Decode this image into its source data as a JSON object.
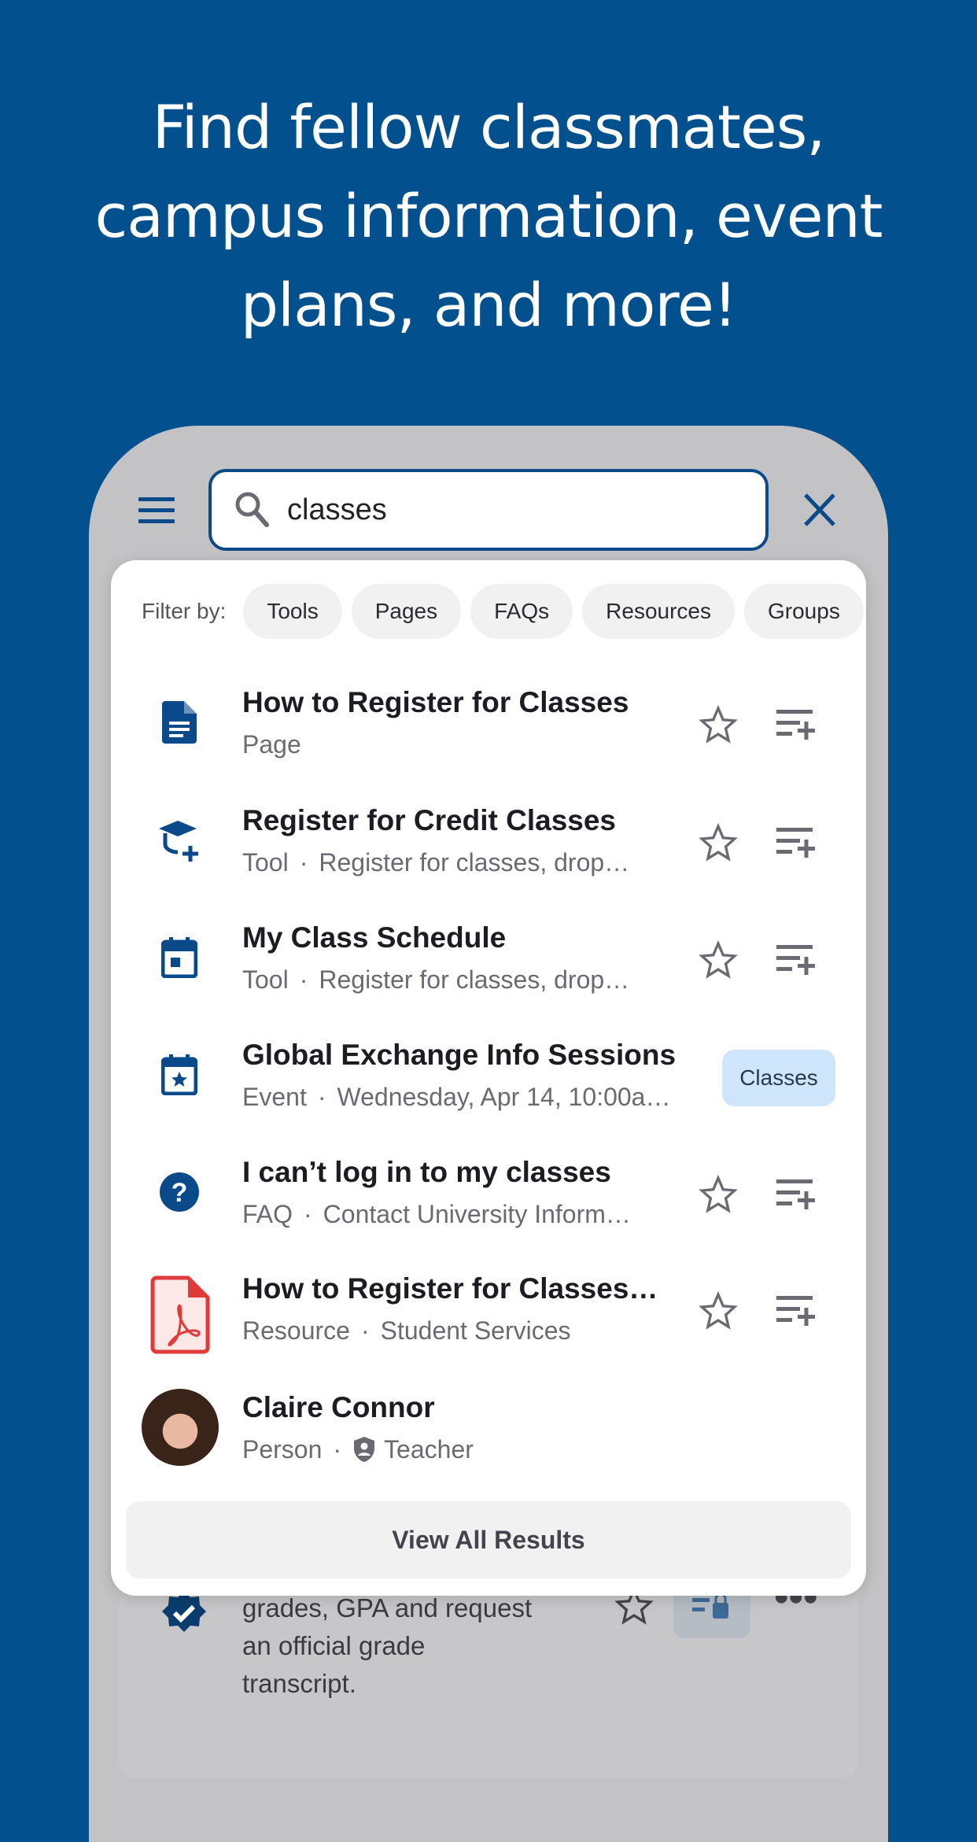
{
  "headline": [
    "Find fellow classmates,",
    "campus information, event",
    "plans, and more!"
  ],
  "search": {
    "value": "classes"
  },
  "filter": {
    "label": "Filter by:",
    "chips": [
      "Tools",
      "Pages",
      "FAQs",
      "Resources",
      "Groups"
    ]
  },
  "results": [
    {
      "title": "How to Register for Classes",
      "type": "Page",
      "detail": "",
      "icon": "document-icon"
    },
    {
      "title": "Register for Credit Classes",
      "type": "Tool",
      "detail": "Register for classes, drop…",
      "icon": "graduation-cap-add-icon"
    },
    {
      "title": "My Class Schedule",
      "type": "Tool",
      "detail": "Register for classes, drop…",
      "icon": "calendar-icon"
    },
    {
      "title": "Global Exchange Info Sessions",
      "type": "Event",
      "detail": "Wednesday, Apr 14, 10:00a…",
      "icon": "calendar-star-icon",
      "tag": "Classes"
    },
    {
      "title": "I can’t log in to my classes",
      "type": "FAQ",
      "detail": "Contact University Inform…",
      "icon": "help-circle-icon"
    },
    {
      "title": "How to Register for Classes…",
      "type": "Resource",
      "detail": "Student Services",
      "icon": "pdf-icon"
    },
    {
      "title": "Claire Connor",
      "type": "Person",
      "detail": "Teacher",
      "icon": "avatar"
    }
  ],
  "view_all": "View All Results",
  "background_card": {
    "lines": [
      "grades, GPA and request",
      "an official grade",
      "transcript."
    ]
  },
  "colors": {
    "brand": "#03508f",
    "accent": "#0a4a8a",
    "tag": "#cfe5fb",
    "pdf": "#e03a3a"
  }
}
